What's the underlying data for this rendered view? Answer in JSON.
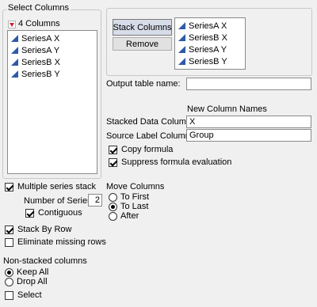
{
  "select_columns": {
    "title": "Select Columns",
    "count_label": "4 Columns",
    "items": [
      "SeriesA X",
      "SeriesA Y",
      "SeriesB X",
      "SeriesB Y"
    ]
  },
  "stack_box": {
    "stack_button": "Stack Columns",
    "remove_button": "Remove",
    "items": [
      "SeriesA X",
      "SeriesB X",
      "SeriesA Y",
      "SeriesB Y"
    ]
  },
  "output_table": {
    "label": "Output table name:",
    "value": ""
  },
  "new_columns": {
    "header": "New Column Names",
    "stacked_label": "Stacked Data Column",
    "stacked_value": "X",
    "source_label": "Source Label Column",
    "source_value": "Group"
  },
  "options": {
    "copy_formula": "Copy formula",
    "suppress_eval": "Suppress formula evaluation"
  },
  "multi_series": {
    "label": "Multiple series stack",
    "num_series_label": "Number of Series",
    "num_series_value": "2",
    "contiguous": "Contiguous"
  },
  "move_columns": {
    "title": "Move Columns",
    "to_first": "To First",
    "to_last": "To Last",
    "after": "After"
  },
  "stack_by_row": "Stack By Row",
  "eliminate_missing": "Eliminate missing rows",
  "non_stacked": {
    "title": "Non-stacked columns",
    "keep_all": "Keep All",
    "drop_all": "Drop All",
    "select": "Select"
  },
  "colors": {
    "accent_triangle": "#2e5aa8",
    "menu_triangle": "#d2202a"
  }
}
